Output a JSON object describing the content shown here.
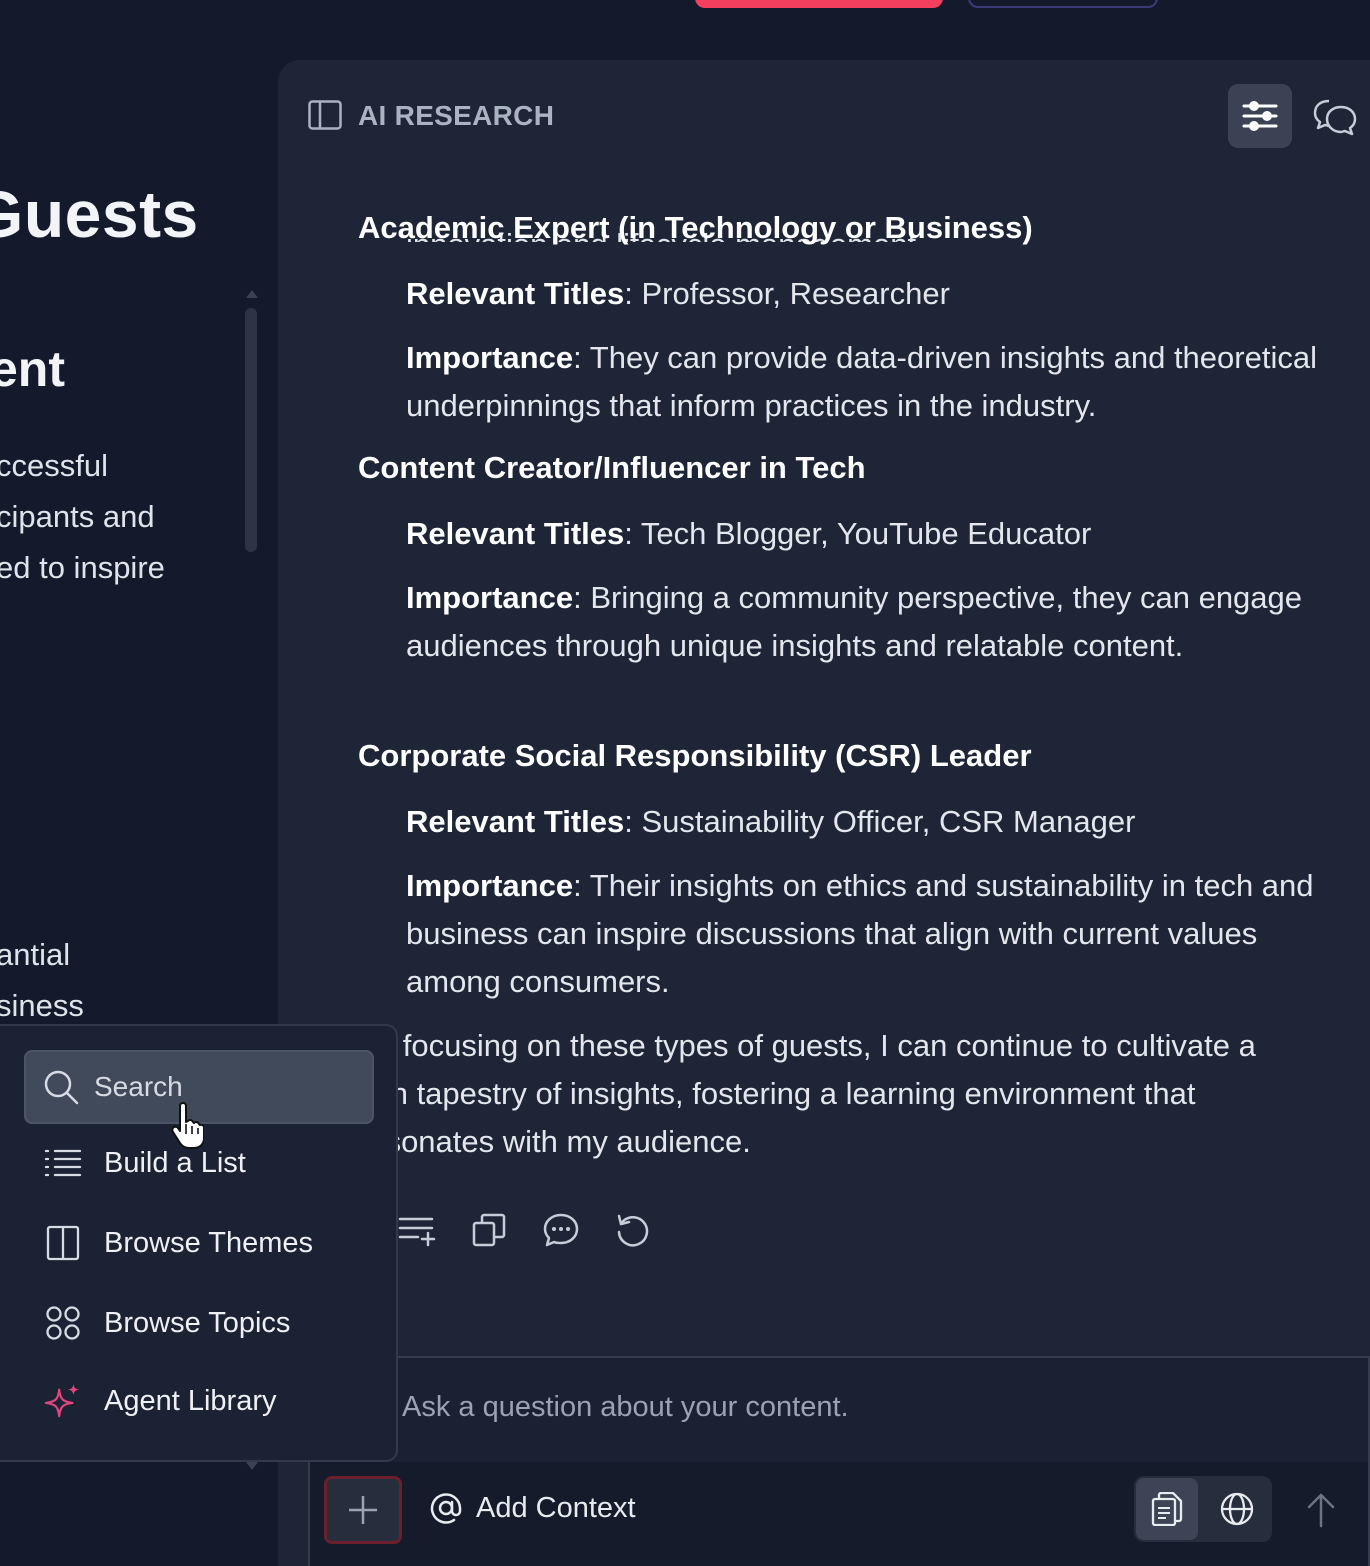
{
  "background_page": {
    "title": "Guests",
    "subtitle": "ent",
    "para1": [
      "ccessful",
      "cipants and",
      "ed to inspire"
    ],
    "para2": [
      "antial",
      "siness"
    ]
  },
  "panel": {
    "title": "AI RESEARCH",
    "cut_line": "innovation and lifecycle management.",
    "sections": [
      {
        "heading": "Academic Expert (in Technology or Business)",
        "titles_label": "Relevant Titles",
        "titles_value": ": Professor, Researcher",
        "importance_label": "Importance",
        "importance_value": ": They can provide data-driven insights and theoretical underpinnings that inform practices in the industry."
      },
      {
        "heading": "Content Creator/Influencer in Tech",
        "titles_label": "Relevant Titles",
        "titles_value": ": Tech Blogger, YouTube Educator",
        "importance_label": "Importance",
        "importance_value": ": Bringing a community perspective, they can engage audiences through unique insights and relatable content."
      },
      {
        "heading": "Corporate Social Responsibility (CSR) Leader",
        "titles_label": "Relevant Titles",
        "titles_value": ": Sustainability Officer, CSR Manager",
        "importance_label": "Importance",
        "importance_value": ": Their insights on ethics and sustainability in tech and business can inspire discussions that align with current values among consumers."
      }
    ],
    "closing": "By focusing on these types of guests, I can continue to cultivate a rich tapestry of insights, fostering a learning environment that resonates with my audience."
  },
  "composer": {
    "placeholder": "Ask a question about your content.",
    "add_context": "Add Context"
  },
  "menu": {
    "search_placeholder": "Search",
    "items": [
      {
        "label": "Build a List",
        "icon": "list-icon"
      },
      {
        "label": "Browse Themes",
        "icon": "columns-icon"
      },
      {
        "label": "Browse Topics",
        "icon": "grid-circles-icon"
      },
      {
        "label": "Agent Library",
        "icon": "sparkle-icon"
      }
    ]
  },
  "colors": {
    "background": "#141a2b",
    "panel": "#1e2536",
    "accent_red": "#f43f5e",
    "sparkle": "#e0457b"
  }
}
